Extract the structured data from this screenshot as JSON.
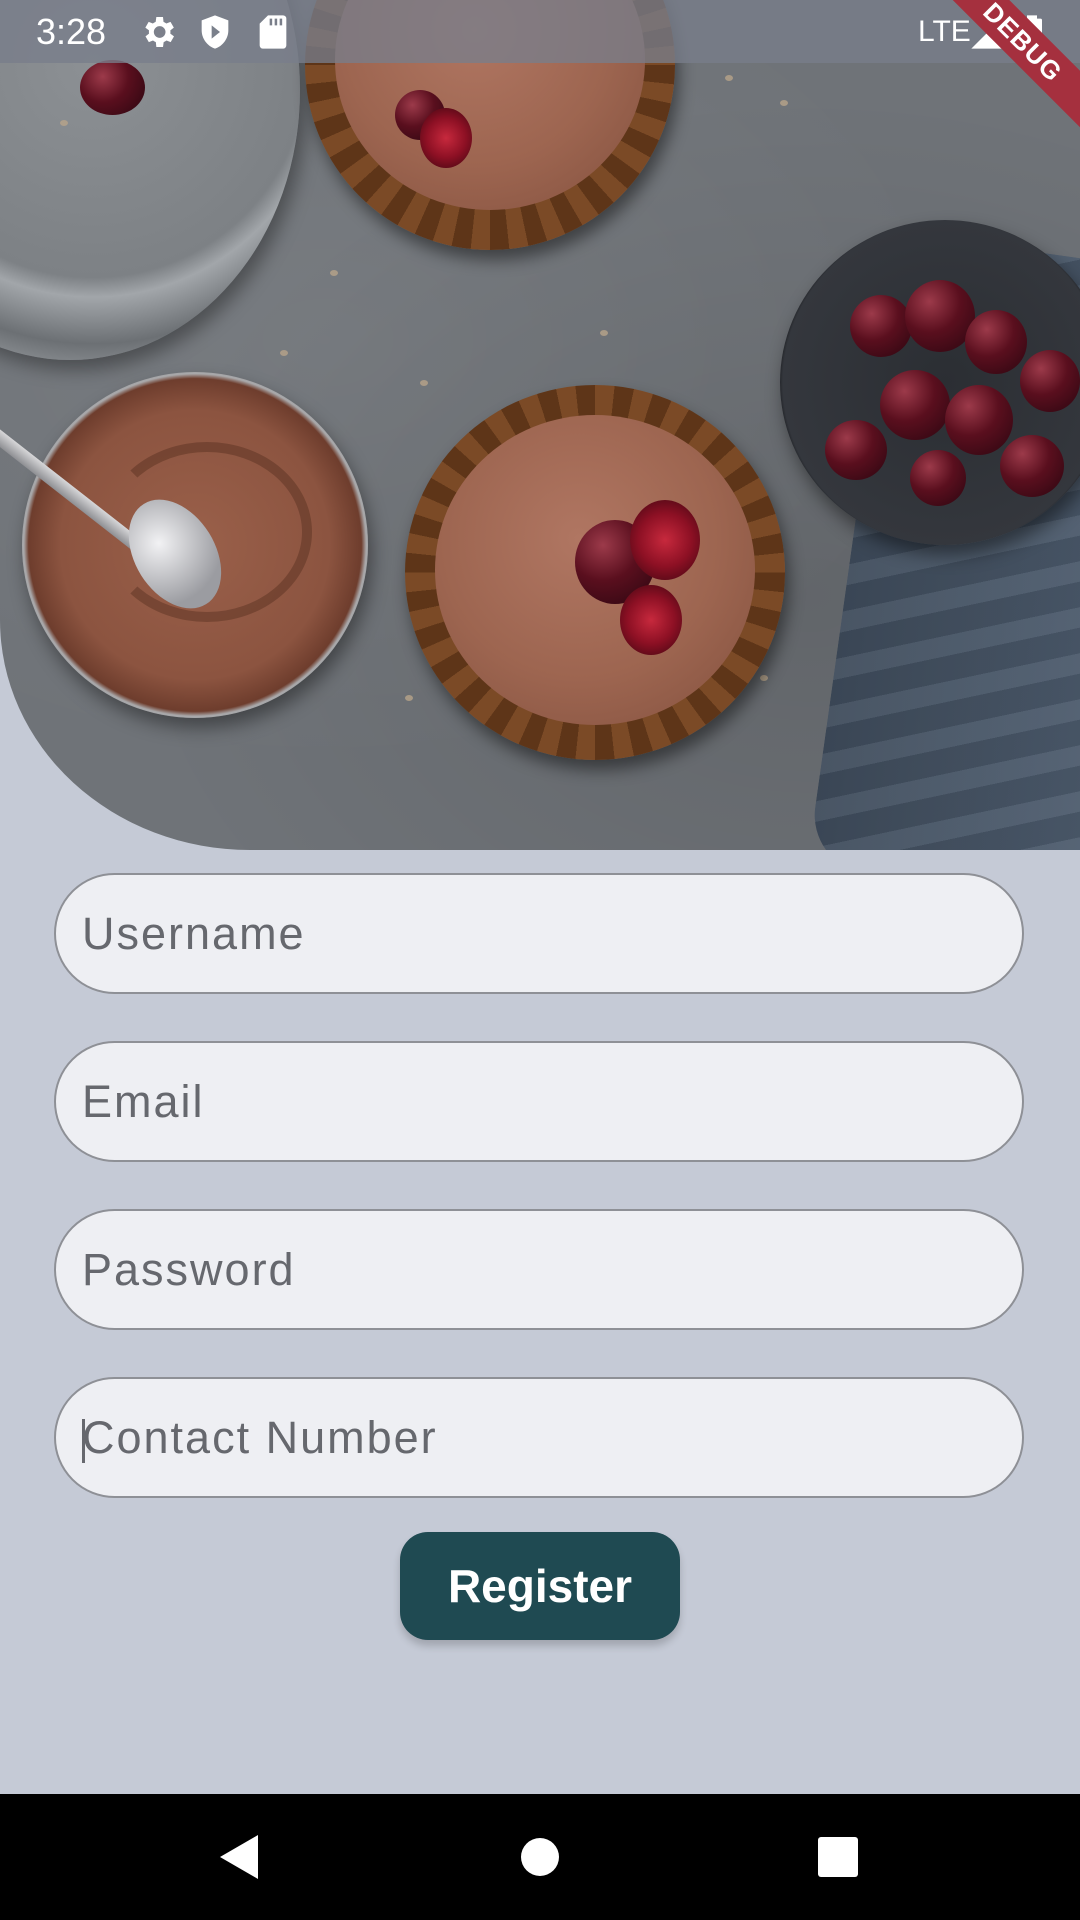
{
  "status_bar": {
    "time": "3:28",
    "network": "LTE",
    "icons": [
      "settings-icon",
      "shield-icon",
      "sd-card-icon",
      "signal-icon",
      "battery-icon"
    ]
  },
  "debug_banner": "DEBUG",
  "hero": {
    "image_alt": "Chocolate tarts with cherries"
  },
  "form": {
    "username_placeholder": "Username",
    "email_placeholder": "Email",
    "password_placeholder": "Password",
    "contact_placeholder": "Contact Number",
    "register_label": "Register"
  },
  "nav_bar": {
    "icons": [
      "back-icon",
      "home-icon",
      "recents-icon"
    ]
  },
  "colors": {
    "background": "#c5cad6",
    "field_background": "#eeeff3",
    "button": "#1f4a52",
    "debug_ribbon": "#a5303e"
  }
}
